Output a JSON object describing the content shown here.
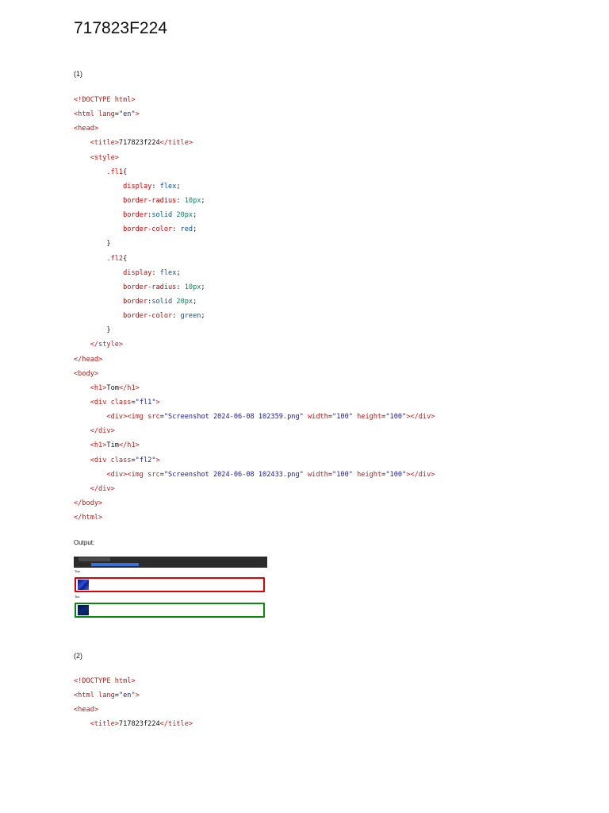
{
  "document": {
    "title": "717823F224",
    "sections": [
      {
        "label": "(1)",
        "lines": [
          [
            {
              "c": "tag",
              "t": "<!DOCTYPE "
            },
            {
              "c": "attr",
              "t": "html"
            },
            {
              "c": "tag",
              "t": ">"
            }
          ],
          [
            {
              "c": "tag",
              "t": "<html "
            },
            {
              "c": "attr",
              "t": "lang"
            },
            {
              "c": "plain",
              "t": "="
            },
            {
              "c": "str",
              "t": "\"en\""
            },
            {
              "c": "tag",
              "t": ">"
            }
          ],
          [
            {
              "c": "tag",
              "t": "<head>"
            }
          ],
          [
            {
              "c": "plain",
              "t": "    "
            },
            {
              "c": "tag",
              "t": "<title>"
            },
            {
              "c": "plain",
              "t": "717823f224"
            },
            {
              "c": "tag",
              "t": "</title>"
            }
          ],
          [
            {
              "c": "plain",
              "t": "    "
            },
            {
              "c": "tag",
              "t": "<style>"
            }
          ],
          [
            {
              "c": "plain",
              "t": "        "
            },
            {
              "c": "prop",
              "t": ".fl1"
            },
            {
              "c": "plain",
              "t": "{"
            }
          ],
          [
            {
              "c": "plain",
              "t": "            "
            },
            {
              "c": "prop",
              "t": "display"
            },
            {
              "c": "plain",
              "t": ": "
            },
            {
              "c": "kw",
              "t": "flex"
            },
            {
              "c": "plain",
              "t": ";"
            }
          ],
          [
            {
              "c": "plain",
              "t": "            "
            },
            {
              "c": "prop",
              "t": "border-radius"
            },
            {
              "c": "plain",
              "t": ": "
            },
            {
              "c": "num",
              "t": "10px"
            },
            {
              "c": "plain",
              "t": ";"
            }
          ],
          [
            {
              "c": "plain",
              "t": "            "
            },
            {
              "c": "prop",
              "t": "border"
            },
            {
              "c": "plain",
              "t": ":"
            },
            {
              "c": "kw",
              "t": "solid"
            },
            {
              "c": "plain",
              "t": " "
            },
            {
              "c": "num",
              "t": "20px"
            },
            {
              "c": "plain",
              "t": ";"
            }
          ],
          [
            {
              "c": "plain",
              "t": "            "
            },
            {
              "c": "prop",
              "t": "border-color"
            },
            {
              "c": "plain",
              "t": ": "
            },
            {
              "c": "kw",
              "t": "red"
            },
            {
              "c": "plain",
              "t": ";"
            }
          ],
          [
            {
              "c": "plain",
              "t": "        }"
            }
          ],
          [
            {
              "c": "plain",
              "t": "        "
            },
            {
              "c": "prop",
              "t": ".fl2"
            },
            {
              "c": "plain",
              "t": "{"
            }
          ],
          [
            {
              "c": "plain",
              "t": "            "
            },
            {
              "c": "prop",
              "t": "display"
            },
            {
              "c": "plain",
              "t": ": "
            },
            {
              "c": "kw",
              "t": "flex"
            },
            {
              "c": "plain",
              "t": ";"
            }
          ],
          [
            {
              "c": "plain",
              "t": "            "
            },
            {
              "c": "prop",
              "t": "border-radius"
            },
            {
              "c": "plain",
              "t": ": "
            },
            {
              "c": "num",
              "t": "10px"
            },
            {
              "c": "plain",
              "t": ";"
            }
          ],
          [
            {
              "c": "plain",
              "t": "            "
            },
            {
              "c": "prop",
              "t": "border"
            },
            {
              "c": "plain",
              "t": ":"
            },
            {
              "c": "kw",
              "t": "solid"
            },
            {
              "c": "plain",
              "t": " "
            },
            {
              "c": "num",
              "t": "20px"
            },
            {
              "c": "plain",
              "t": ";"
            }
          ],
          [
            {
              "c": "plain",
              "t": "            "
            },
            {
              "c": "prop",
              "t": "border-color"
            },
            {
              "c": "plain",
              "t": ": "
            },
            {
              "c": "kw",
              "t": "green"
            },
            {
              "c": "plain",
              "t": ";"
            }
          ],
          [
            {
              "c": "plain",
              "t": "        }"
            }
          ],
          [
            {
              "c": "plain",
              "t": "    "
            },
            {
              "c": "tag",
              "t": "</style>"
            }
          ],
          [
            {
              "c": "tag",
              "t": "</head>"
            }
          ],
          [
            {
              "c": "tag",
              "t": "<body>"
            }
          ],
          [
            {
              "c": "plain",
              "t": "    "
            },
            {
              "c": "tag",
              "t": "<h1>"
            },
            {
              "c": "plain",
              "t": "Tom"
            },
            {
              "c": "tag",
              "t": "</h1>"
            }
          ],
          [
            {
              "c": "plain",
              "t": "    "
            },
            {
              "c": "tag",
              "t": "<div "
            },
            {
              "c": "attr",
              "t": "class"
            },
            {
              "c": "plain",
              "t": "="
            },
            {
              "c": "str",
              "t": "\"fl1\""
            },
            {
              "c": "tag",
              "t": ">"
            }
          ],
          [
            {
              "c": "plain",
              "t": "        "
            },
            {
              "c": "tag",
              "t": "<div><img "
            },
            {
              "c": "attr",
              "t": "src"
            },
            {
              "c": "plain",
              "t": "="
            },
            {
              "c": "str",
              "t": "\"Screenshot 2024-06-08 102359.png\""
            },
            {
              "c": "plain",
              "t": " "
            },
            {
              "c": "attr",
              "t": "width"
            },
            {
              "c": "plain",
              "t": "="
            },
            {
              "c": "str",
              "t": "\"100\""
            },
            {
              "c": "plain",
              "t": " "
            },
            {
              "c": "attr",
              "t": "height"
            },
            {
              "c": "plain",
              "t": "="
            },
            {
              "c": "str",
              "t": "\"100\""
            },
            {
              "c": "tag",
              "t": "></div>"
            }
          ],
          [
            {
              "c": "plain",
              "t": "    "
            },
            {
              "c": "tag",
              "t": "</div>"
            }
          ],
          [
            {
              "c": "plain",
              "t": "    "
            },
            {
              "c": "tag",
              "t": "<h1>"
            },
            {
              "c": "plain",
              "t": "Tim"
            },
            {
              "c": "tag",
              "t": "</h1>"
            }
          ],
          [
            {
              "c": "plain",
              "t": "    "
            },
            {
              "c": "tag",
              "t": "<div "
            },
            {
              "c": "attr",
              "t": "class"
            },
            {
              "c": "plain",
              "t": "="
            },
            {
              "c": "str",
              "t": "\"fl2\""
            },
            {
              "c": "tag",
              "t": ">"
            }
          ],
          [
            {
              "c": "plain",
              "t": "        "
            },
            {
              "c": "tag",
              "t": "<div><img "
            },
            {
              "c": "attr",
              "t": "src"
            },
            {
              "c": "plain",
              "t": "="
            },
            {
              "c": "str",
              "t": "\"Screenshot 2024-06-08 102433.png\""
            },
            {
              "c": "plain",
              "t": " "
            },
            {
              "c": "attr",
              "t": "width"
            },
            {
              "c": "plain",
              "t": "="
            },
            {
              "c": "str",
              "t": "\"100\""
            },
            {
              "c": "plain",
              "t": " "
            },
            {
              "c": "attr",
              "t": "height"
            },
            {
              "c": "plain",
              "t": "="
            },
            {
              "c": "str",
              "t": "\"100\""
            },
            {
              "c": "tag",
              "t": "></div>"
            }
          ],
          [
            {
              "c": "plain",
              "t": "    "
            },
            {
              "c": "tag",
              "t": "</div>"
            }
          ],
          [
            {
              "c": "tag",
              "t": "</body>"
            }
          ],
          [
            {
              "c": "tag",
              "t": "</html>"
            }
          ]
        ]
      },
      {
        "label": "(2)",
        "lines": [
          [
            {
              "c": "tag",
              "t": "<!DOCTYPE "
            },
            {
              "c": "attr",
              "t": "html"
            },
            {
              "c": "tag",
              "t": ">"
            }
          ],
          [
            {
              "c": "tag",
              "t": "<html "
            },
            {
              "c": "attr",
              "t": "lang"
            },
            {
              "c": "plain",
              "t": "="
            },
            {
              "c": "str",
              "t": "\"en\""
            },
            {
              "c": "tag",
              "t": ">"
            }
          ],
          [
            {
              "c": "tag",
              "t": "<head>"
            }
          ],
          [
            {
              "c": "plain",
              "t": "    "
            },
            {
              "c": "tag",
              "t": "<title>"
            },
            {
              "c": "plain",
              "t": "717823f224"
            },
            {
              "c": "tag",
              "t": "</title>"
            }
          ]
        ]
      }
    ],
    "output": {
      "label": "Output:",
      "box1_heading": "Tom",
      "box2_heading": "Tim",
      "box1_color": "#e00000",
      "box2_color": "#0a8a0a"
    }
  }
}
